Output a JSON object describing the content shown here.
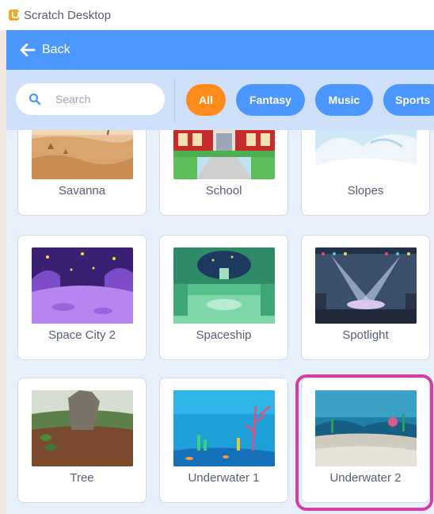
{
  "window": {
    "title": "Scratch Desktop"
  },
  "menubar": {
    "back_label": "Back"
  },
  "search": {
    "placeholder": "Search"
  },
  "tags": [
    "All",
    "Fantasy",
    "Music",
    "Sports"
  ],
  "colors": {
    "menubar": "#4c97ff",
    "filterbar": "#cfe0fb",
    "tag_active": "#ff8c1a",
    "tag_inactive": "#4c97ff",
    "highlight": "#d23ea6"
  },
  "backdrops": [
    {
      "label": "Savanna",
      "icon": "savanna-thumbnail"
    },
    {
      "label": "School",
      "icon": "school-thumbnail"
    },
    {
      "label": "Slopes",
      "icon": "slopes-thumbnail"
    },
    {
      "label": "Space City 2",
      "icon": "space-city-thumbnail"
    },
    {
      "label": "Spaceship",
      "icon": "spaceship-thumbnail"
    },
    {
      "label": "Spotlight",
      "icon": "spotlight-thumbnail"
    },
    {
      "label": "Tree",
      "icon": "tree-thumbnail"
    },
    {
      "label": "Underwater 1",
      "icon": "underwater-thumbnail"
    },
    {
      "label": "Underwater 2",
      "icon": "underwater-thumbnail"
    }
  ],
  "highlighted_item": "Underwater 2"
}
